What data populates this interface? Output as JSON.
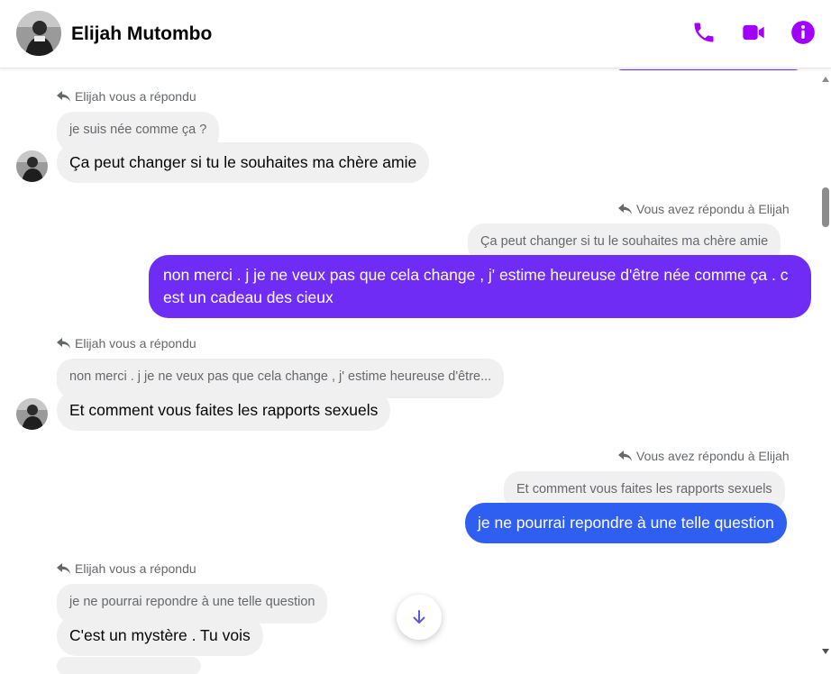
{
  "header": {
    "contact_name": "Elijah Mutombo",
    "icons": [
      "phone-icon",
      "video-icon",
      "info-icon"
    ],
    "accent_color": "#a100ff"
  },
  "colors": {
    "outgoing_purple": "#6e2cf4",
    "outgoing_blue": "#2f5ff0",
    "incoming_bg": "#f0f0f0"
  },
  "messages": [
    {
      "direction": "incoming",
      "reply_label": "Elijah vous a répondu",
      "quoted": "je suis née comme ça ?",
      "text": "Ça peut changer si tu le souhaites ma chère amie"
    },
    {
      "direction": "outgoing",
      "reply_label": "Vous avez répondu à Elijah",
      "quoted": "Ça peut changer si tu le souhaites ma chère amie",
      "text": "non merci . j je ne veux pas que cela change , j' estime heureuse d'être née comme ça . c est un cadeau des cieux"
    },
    {
      "direction": "incoming",
      "reply_label": "Elijah vous a répondu",
      "quoted": "non merci . j je ne veux pas que cela change , j' estime heureuse d'être...",
      "text": "Et comment vous faites les rapports sexuels"
    },
    {
      "direction": "outgoing",
      "reply_label": "Vous avez répondu à Elijah",
      "quoted": "Et comment vous faites les rapports sexuels",
      "text": "je ne pourrai repondre à une telle question"
    },
    {
      "direction": "incoming",
      "reply_label": "Elijah vous a répondu",
      "quoted": "je ne pourrai repondre à une telle question",
      "text": "C'est un mystère . Tu vois"
    }
  ],
  "scroll_to_bottom_icon": "arrow-down-icon"
}
